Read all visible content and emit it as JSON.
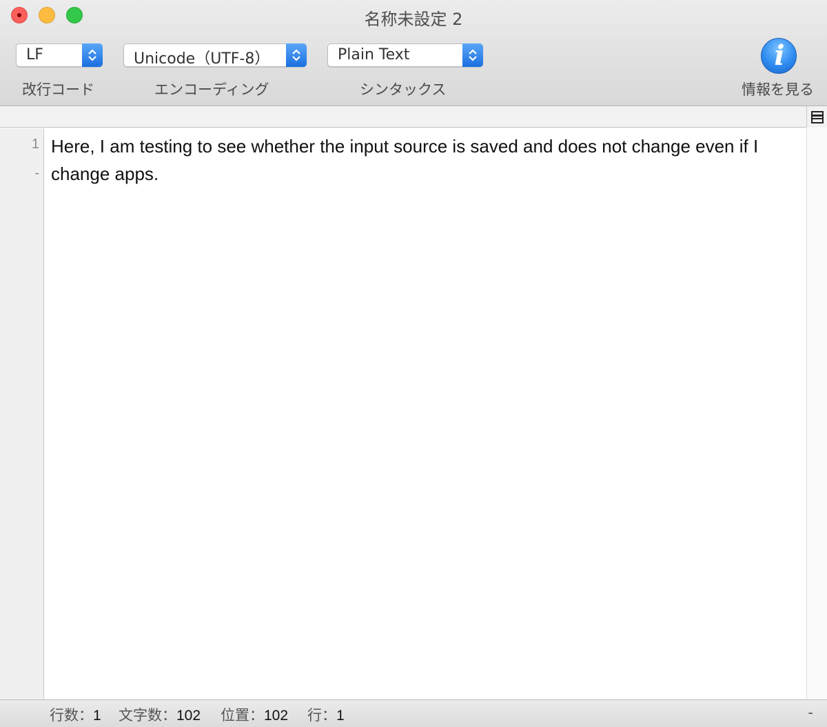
{
  "window": {
    "title": "名称未設定 2"
  },
  "toolbar": {
    "line_ending": {
      "value": "LF",
      "label": "改行コード"
    },
    "encoding": {
      "value": "Unicode（UTF-8）",
      "label": "エンコーディング"
    },
    "syntax": {
      "value": "Plain Text",
      "label": "シンタックス"
    },
    "info": {
      "icon": "i",
      "label": "情報を見る"
    }
  },
  "gutter": {
    "lines": [
      "1",
      "-"
    ]
  },
  "editor": {
    "text": "Here, I am testing to see whether the input source is saved and does not change even if I change apps."
  },
  "status": {
    "lines_label": "行数：",
    "lines_value": "1",
    "chars_label": "文字数：",
    "chars_value": "102",
    "position_label": "位置：",
    "position_value": "102",
    "row_label": "行：",
    "row_value": "1",
    "right": "-"
  },
  "colors": {
    "accent": "#1a6fe0",
    "close": "#fc605c",
    "minimize": "#fdbc40",
    "maximize": "#34c84a"
  }
}
